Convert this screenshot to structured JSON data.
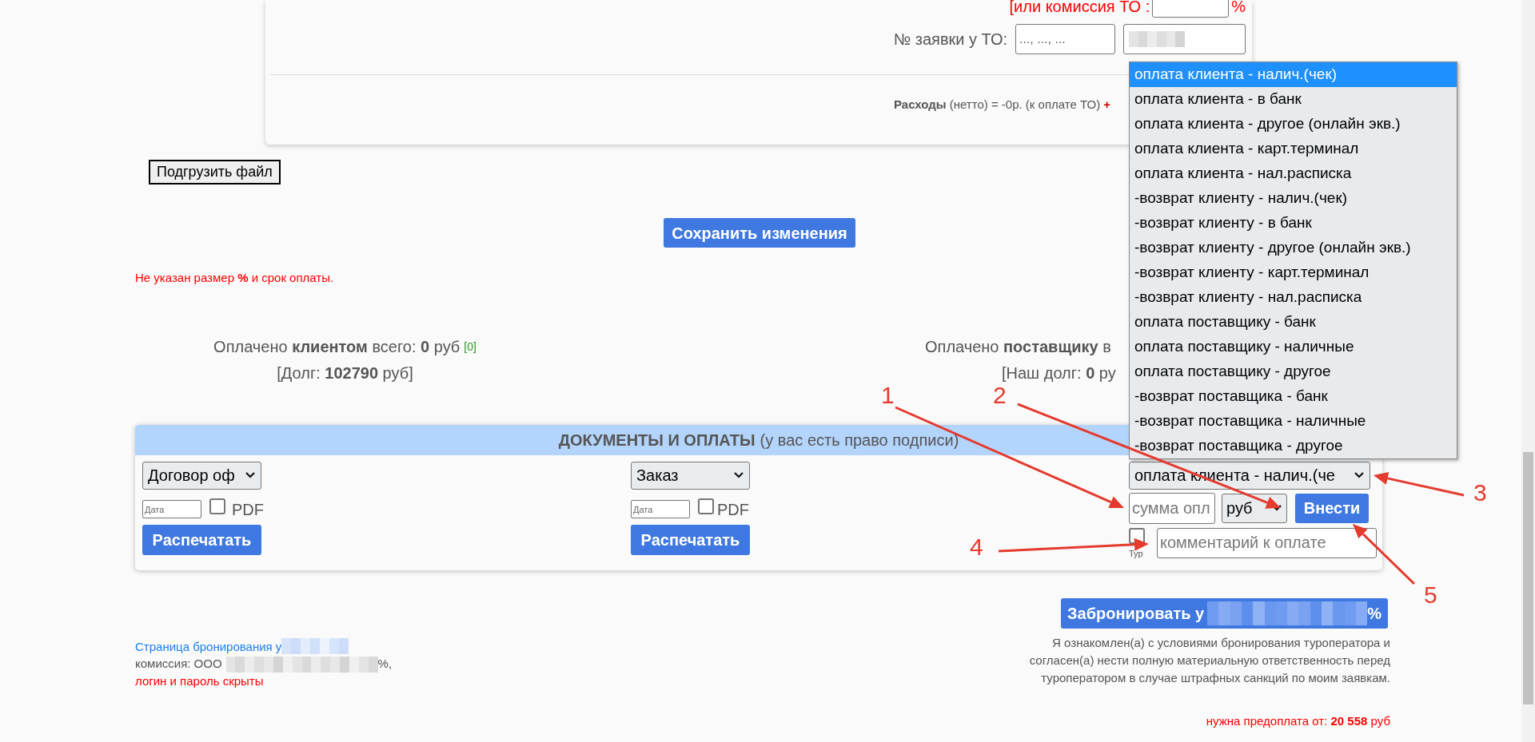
{
  "commission": {
    "label": "[или комиссия ТО :",
    "suffix": "%"
  },
  "order_number": {
    "label": "№ заявки у ТО:",
    "placeholder": "..., ..., ..."
  },
  "expenses": {
    "text": "**Расходы** (нетто) = -0р. (к оплате ТО)",
    "plus": "+"
  },
  "upload_button": "Подгрузить файл",
  "save_button": "Сохранить изменения",
  "warning": "Не указан размер **%** и срок оплаты.",
  "client_summary": {
    "paid": "Оплачено **клиентом** всего: **0** руб",
    "paid_count": "[0]",
    "debt": "[Долг: **102790** руб]"
  },
  "supplier_summary": {
    "paid": "Оплачено **поставщику** в",
    "debt": "[Наш долг: **0** ру"
  },
  "documents": {
    "title": "ДОКУМЕНТЫ И ОПЛАТЫ",
    "subtitle": "(у вас есть право подписи)",
    "forms": [
      {
        "select": "Договор оф",
        "date_placeholder": "Дата",
        "pdf": {
          "label": "PDF",
          "checked": false
        },
        "print_button": "Распечатать"
      },
      {
        "select": "Заказ",
        "date_placeholder": "Дата",
        "pdf": {
          "label": "PDF",
          "checked": false
        },
        "print_button": "Распечатать"
      }
    ],
    "payment": {
      "type_select": "оплата клиента - налич.(че",
      "amount_placeholder": "сумма опл",
      "currency": "руб",
      "submit_button": "Внести",
      "tour": {
        "label": "Тур",
        "checked": false
      },
      "comment_placeholder": "комментарий к оплате"
    }
  },
  "payment_type_options": [
    {
      "label": "оплата клиента - налич.(чек)",
      "selected": true
    },
    {
      "label": "оплата клиента - в банк",
      "selected": false
    },
    {
      "label": "оплата клиента - другое (онлайн экв.)",
      "selected": false
    },
    {
      "label": "оплата клиента - карт.терминал",
      "selected": false
    },
    {
      "label": "оплата клиента - нал.расписка",
      "selected": false
    },
    {
      "label": "-возврат клиенту - налич.(чек)",
      "selected": false
    },
    {
      "label": "-возврат клиенту - в банк",
      "selected": false
    },
    {
      "label": "-возврат клиенту - другое (онлайн экв.)",
      "selected": false
    },
    {
      "label": "-возврат клиенту - карт.терминал",
      "selected": false
    },
    {
      "label": "-возврат клиенту - нал.расписка",
      "selected": false
    },
    {
      "label": "оплата поставщику - банк",
      "selected": false
    },
    {
      "label": "оплата поставщику - наличные",
      "selected": false
    },
    {
      "label": "оплата поставщику - другое",
      "selected": false
    },
    {
      "label": "-возврат поставщика - банк",
      "selected": false
    },
    {
      "label": "-возврат поставщика - наличные",
      "selected": false
    },
    {
      "label": "-возврат поставщика - другое",
      "selected": false
    }
  ],
  "booking": {
    "page_link": "Страница бронирования у",
    "commission": "комиссия: ООО",
    "commission_suffix": "%,",
    "login_note": "логин и пароль скрыты",
    "book_button": {
      "prefix": "Забронировать у",
      "suffix": "%"
    },
    "agreement": "Я ознакомлен(а) с условиями бронирования туроператора и согласен(а) нести полную материальную ответственность перед туроператором в случае штрафных санкций по моим заявкам.",
    "prepayment": "нужна предоплата от: **20 558** руб"
  },
  "annotations": [
    "1",
    "2",
    "3",
    "4",
    "5"
  ]
}
